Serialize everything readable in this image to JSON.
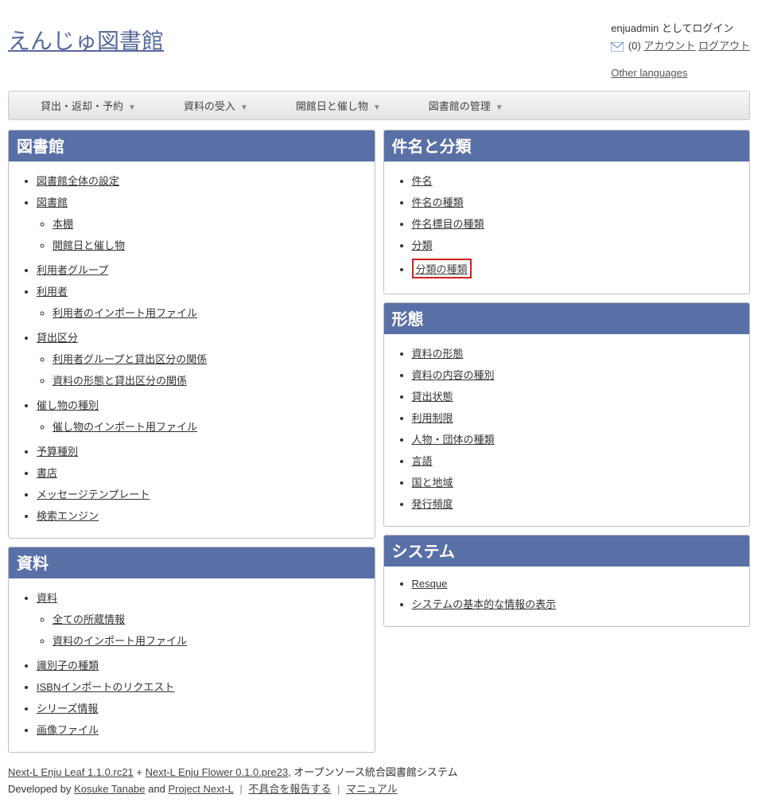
{
  "header": {
    "title": "えんじゅ図書館",
    "login_as_prefix": "enjuadmin",
    "login_as_suffix": " としてログイン",
    "unread_count": "(0)",
    "account_link": "アカウント",
    "logout_link": "ログアウト",
    "other_languages": "Other languages"
  },
  "menubar": {
    "items": [
      "貸出・返却・予約",
      "資料の受入",
      "開館日と催し物",
      "図書館の管理"
    ]
  },
  "panels": {
    "library": {
      "title": "図書館",
      "conf": "図書館全体の設定",
      "library": "図書館",
      "shelf": "本棚",
      "events": "開館日と催し物",
      "user_group": "利用者グループ",
      "patron": "利用者",
      "patron_import": "利用者のインポート用ファイル",
      "checkout_type": "貸出区分",
      "usergroup_checkout": "利用者グループと貸出区分の関係",
      "carrier_checkout": "資料の形態と貸出区分の関係",
      "event_category": "催し物の種別",
      "event_import": "催し物のインポート用ファイル",
      "budget": "予算種別",
      "bookstore": "書店",
      "msg_template": "メッセージテンプレート",
      "search_engine": "検索エンジン"
    },
    "material": {
      "title": "資料",
      "resource": "資料",
      "items": "全ての所蔵情報",
      "import": "資料のインポート用ファイル",
      "identifier": "識別子の種類",
      "isbn": "ISBNインポートのリクエスト",
      "series": "シリーズ情報",
      "image": "画像ファイル"
    },
    "subject": {
      "title": "件名と分類",
      "subject": "件名",
      "subject_type": "件名の種類",
      "subject_heading": "件名標目の種類",
      "classification": "分類",
      "classification_type": "分類の種類"
    },
    "form": {
      "title": "形態",
      "carrier": "資料の形態",
      "content": "資料の内容の種別",
      "circ_status": "貸出状態",
      "restriction": "利用制限",
      "agent_type": "人物・団体の種類",
      "language": "言語",
      "country": "国と地域",
      "frequency": "発行頻度"
    },
    "system": {
      "title": "システム",
      "resque": "Resque",
      "basic_info": "システムの基本的な情報の表示"
    }
  },
  "footer": {
    "leaf": "Next-L Enju Leaf 1.1.0.rc21",
    "plus": " + ",
    "flower": "Next-L Enju Flower 0.1.0.pre23",
    "descr": ", オープンソース統合図書館システム",
    "dev_by": "Developed by ",
    "kosuke": "Kosuke Tanabe",
    "and": " and ",
    "project": "Project Next-L",
    "report": "不具合を報告する",
    "manual": "マニュアル"
  }
}
